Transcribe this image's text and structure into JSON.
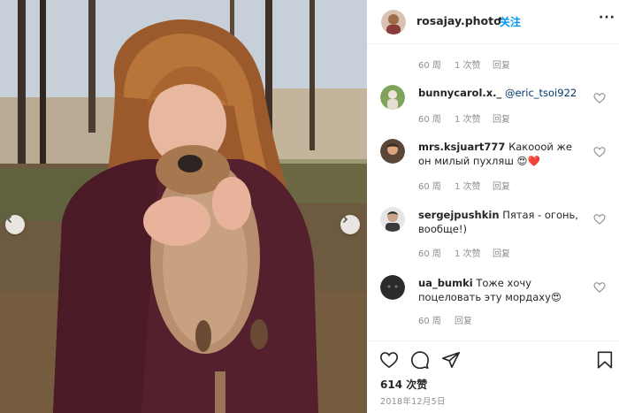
{
  "post": {
    "username": "rosajay.photo",
    "dot": "•",
    "follow_label": "关注",
    "more_label": "···"
  },
  "top_meta": {
    "time": "60 周",
    "likes": "1 次赞",
    "reply": "回复"
  },
  "comments": [
    {
      "username": "bunnycarol.x._",
      "mention": "@eric_tsoi922",
      "text": "",
      "time": "60 周",
      "likes": "1 次赞",
      "reply": "回复"
    },
    {
      "username": "mrs.ksjuart777",
      "mention": "",
      "text": "Какооой же он милый пухляш 😍❤️",
      "time": "60 周",
      "likes": "1 次赞",
      "reply": "回复"
    },
    {
      "username": "sergejpushkin",
      "mention": "",
      "text": "Пятая - огонь, вообще!)",
      "time": "60 周",
      "likes": "1 次赞",
      "reply": "回复"
    },
    {
      "username": "ua_bumki",
      "mention": "",
      "text": "Тоже хочу поцеловать эту мордаху😍",
      "time": "60 周",
      "likes": "",
      "reply": "回复"
    }
  ],
  "footer": {
    "likes": "614 次赞",
    "date": "2018年12月5日"
  },
  "icons": {
    "like": "heart-icon",
    "comment": "comment-icon",
    "share": "share-icon",
    "save": "bookmark-icon",
    "carousel_prev": "chevron-left-icon",
    "carousel_next": "chevron-right-icon"
  },
  "colors": {
    "accent": "#0095f6",
    "text": "#262626",
    "muted": "#8e8e8e",
    "heart": "#ed4956"
  }
}
